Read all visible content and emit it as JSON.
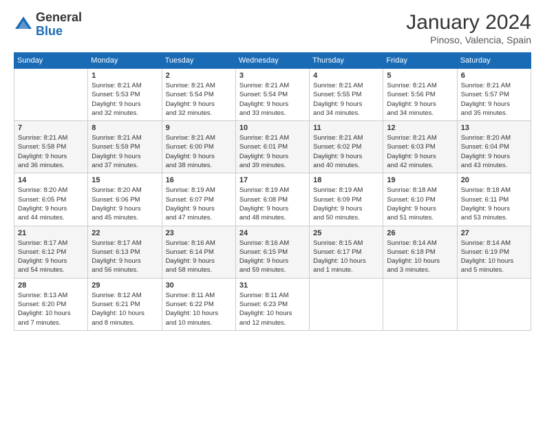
{
  "header": {
    "logo_general": "General",
    "logo_blue": "Blue",
    "month_title": "January 2024",
    "location": "Pinoso, Valencia, Spain"
  },
  "days_of_week": [
    "Sunday",
    "Monday",
    "Tuesday",
    "Wednesday",
    "Thursday",
    "Friday",
    "Saturday"
  ],
  "weeks": [
    {
      "alt": false,
      "days": [
        {
          "num": "",
          "info": ""
        },
        {
          "num": "1",
          "info": "Sunrise: 8:21 AM\nSunset: 5:53 PM\nDaylight: 9 hours\nand 32 minutes."
        },
        {
          "num": "2",
          "info": "Sunrise: 8:21 AM\nSunset: 5:54 PM\nDaylight: 9 hours\nand 32 minutes."
        },
        {
          "num": "3",
          "info": "Sunrise: 8:21 AM\nSunset: 5:54 PM\nDaylight: 9 hours\nand 33 minutes."
        },
        {
          "num": "4",
          "info": "Sunrise: 8:21 AM\nSunset: 5:55 PM\nDaylight: 9 hours\nand 34 minutes."
        },
        {
          "num": "5",
          "info": "Sunrise: 8:21 AM\nSunset: 5:56 PM\nDaylight: 9 hours\nand 34 minutes."
        },
        {
          "num": "6",
          "info": "Sunrise: 8:21 AM\nSunset: 5:57 PM\nDaylight: 9 hours\nand 35 minutes."
        }
      ]
    },
    {
      "alt": true,
      "days": [
        {
          "num": "7",
          "info": "Sunrise: 8:21 AM\nSunset: 5:58 PM\nDaylight: 9 hours\nand 36 minutes."
        },
        {
          "num": "8",
          "info": "Sunrise: 8:21 AM\nSunset: 5:59 PM\nDaylight: 9 hours\nand 37 minutes."
        },
        {
          "num": "9",
          "info": "Sunrise: 8:21 AM\nSunset: 6:00 PM\nDaylight: 9 hours\nand 38 minutes."
        },
        {
          "num": "10",
          "info": "Sunrise: 8:21 AM\nSunset: 6:01 PM\nDaylight: 9 hours\nand 39 minutes."
        },
        {
          "num": "11",
          "info": "Sunrise: 8:21 AM\nSunset: 6:02 PM\nDaylight: 9 hours\nand 40 minutes."
        },
        {
          "num": "12",
          "info": "Sunrise: 8:21 AM\nSunset: 6:03 PM\nDaylight: 9 hours\nand 42 minutes."
        },
        {
          "num": "13",
          "info": "Sunrise: 8:20 AM\nSunset: 6:04 PM\nDaylight: 9 hours\nand 43 minutes."
        }
      ]
    },
    {
      "alt": false,
      "days": [
        {
          "num": "14",
          "info": "Sunrise: 8:20 AM\nSunset: 6:05 PM\nDaylight: 9 hours\nand 44 minutes."
        },
        {
          "num": "15",
          "info": "Sunrise: 8:20 AM\nSunset: 6:06 PM\nDaylight: 9 hours\nand 45 minutes."
        },
        {
          "num": "16",
          "info": "Sunrise: 8:19 AM\nSunset: 6:07 PM\nDaylight: 9 hours\nand 47 minutes."
        },
        {
          "num": "17",
          "info": "Sunrise: 8:19 AM\nSunset: 6:08 PM\nDaylight: 9 hours\nand 48 minutes."
        },
        {
          "num": "18",
          "info": "Sunrise: 8:19 AM\nSunset: 6:09 PM\nDaylight: 9 hours\nand 50 minutes."
        },
        {
          "num": "19",
          "info": "Sunrise: 8:18 AM\nSunset: 6:10 PM\nDaylight: 9 hours\nand 51 minutes."
        },
        {
          "num": "20",
          "info": "Sunrise: 8:18 AM\nSunset: 6:11 PM\nDaylight: 9 hours\nand 53 minutes."
        }
      ]
    },
    {
      "alt": true,
      "days": [
        {
          "num": "21",
          "info": "Sunrise: 8:17 AM\nSunset: 6:12 PM\nDaylight: 9 hours\nand 54 minutes."
        },
        {
          "num": "22",
          "info": "Sunrise: 8:17 AM\nSunset: 6:13 PM\nDaylight: 9 hours\nand 56 minutes."
        },
        {
          "num": "23",
          "info": "Sunrise: 8:16 AM\nSunset: 6:14 PM\nDaylight: 9 hours\nand 58 minutes."
        },
        {
          "num": "24",
          "info": "Sunrise: 8:16 AM\nSunset: 6:15 PM\nDaylight: 9 hours\nand 59 minutes."
        },
        {
          "num": "25",
          "info": "Sunrise: 8:15 AM\nSunset: 6:17 PM\nDaylight: 10 hours\nand 1 minute."
        },
        {
          "num": "26",
          "info": "Sunrise: 8:14 AM\nSunset: 6:18 PM\nDaylight: 10 hours\nand 3 minutes."
        },
        {
          "num": "27",
          "info": "Sunrise: 8:14 AM\nSunset: 6:19 PM\nDaylight: 10 hours\nand 5 minutes."
        }
      ]
    },
    {
      "alt": false,
      "days": [
        {
          "num": "28",
          "info": "Sunrise: 8:13 AM\nSunset: 6:20 PM\nDaylight: 10 hours\nand 7 minutes."
        },
        {
          "num": "29",
          "info": "Sunrise: 8:12 AM\nSunset: 6:21 PM\nDaylight: 10 hours\nand 8 minutes."
        },
        {
          "num": "30",
          "info": "Sunrise: 8:11 AM\nSunset: 6:22 PM\nDaylight: 10 hours\nand 10 minutes."
        },
        {
          "num": "31",
          "info": "Sunrise: 8:11 AM\nSunset: 6:23 PM\nDaylight: 10 hours\nand 12 minutes."
        },
        {
          "num": "",
          "info": ""
        },
        {
          "num": "",
          "info": ""
        },
        {
          "num": "",
          "info": ""
        }
      ]
    }
  ]
}
